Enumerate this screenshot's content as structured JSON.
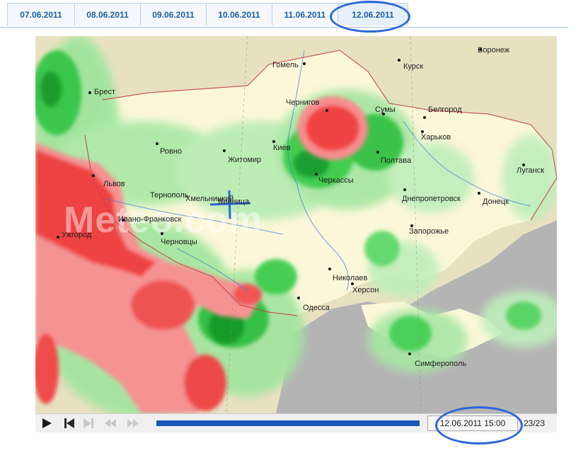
{
  "tabs": [
    {
      "label": "07.06.2011",
      "active": false
    },
    {
      "label": "08.06.2011",
      "active": false
    },
    {
      "label": "09.06.2011",
      "active": false
    },
    {
      "label": "10.06.2011",
      "active": false
    },
    {
      "label": "11.06.2011",
      "active": false
    },
    {
      "label": "12.06.2011",
      "active": true
    }
  ],
  "map": {
    "watermark": "Meteo.com",
    "cities": [
      "Воронеж",
      "Гомель",
      "Курск",
      "Брест",
      "Чернигов",
      "Сумы",
      "Белгород",
      "Харьков",
      "Ровно",
      "Житомир",
      "Киев",
      "Полтава",
      "Луганск",
      "Львов",
      "Черкассы",
      "Тернополь",
      "Хмельницкий",
      "Винница",
      "Днепропетровск",
      "Донецк",
      "Ужгород",
      "Ивано-Франковск",
      "Запорожье",
      "Черновцы",
      "Николаев",
      "Херсон",
      "Одесса",
      "Симферополь"
    ]
  },
  "player": {
    "buttons": [
      "play-icon",
      "step-back-icon",
      "step-forward-icon",
      "rewind-icon",
      "fast-forward-icon"
    ],
    "progress": 1.0,
    "timestamp": "12.06.2011 15:00",
    "frame_counter": "23/23"
  },
  "colors": {
    "tab_text": "#1c5fa3",
    "annotation_ink": "#2f67d6",
    "rain_heavy": "#ef3b3b",
    "rain_light": "#3fcf4f",
    "sea": "#b4b4b4",
    "land": "#fbf7d9",
    "progress": "#1b57b8"
  }
}
